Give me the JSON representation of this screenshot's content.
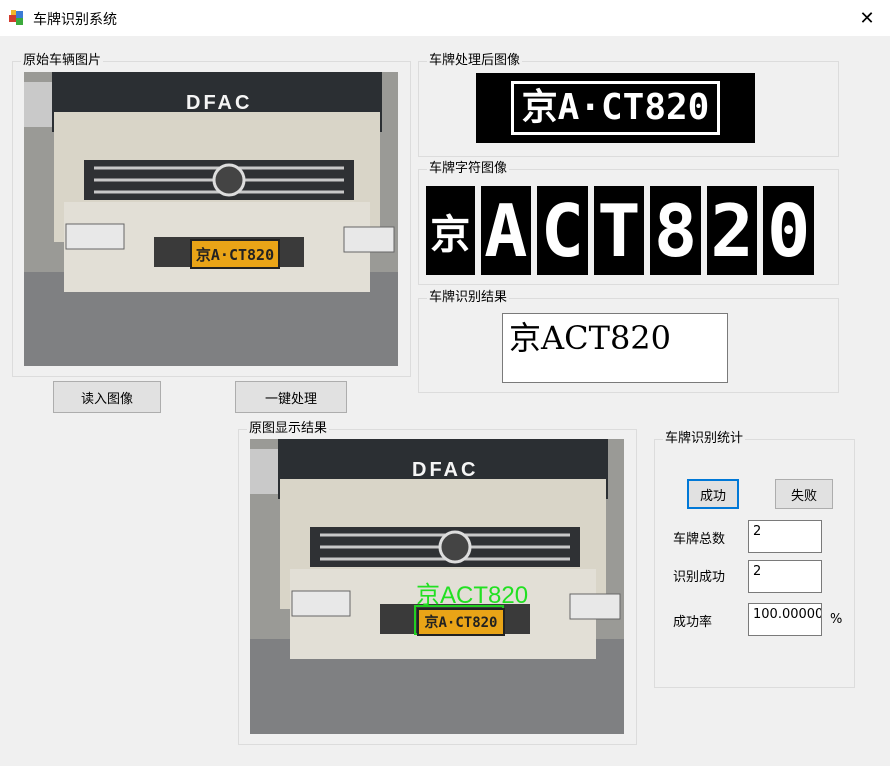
{
  "window": {
    "title": "车牌识别系统",
    "close_glyph": "✕"
  },
  "original_image": {
    "group_label": "原始车辆图片",
    "brand_text": "DFAC",
    "plate_text": "京A·CT820"
  },
  "processed_plate": {
    "group_label": "车牌处理后图像",
    "plate_text": "京A·CT820"
  },
  "char_images": {
    "group_label": "车牌字符图像",
    "chars": [
      "京",
      "A",
      "C",
      "T",
      "8",
      "2",
      "0"
    ]
  },
  "recognition_result": {
    "group_label": "车牌识别结果",
    "value": "京ACT820"
  },
  "buttons": {
    "read_image": "读入图像",
    "one_click": "一键处理"
  },
  "result_display": {
    "group_label": "原图显示结果",
    "overlay_text": "京ACT820",
    "brand_text": "DFAC",
    "plate_text": "京A·CT820"
  },
  "stats": {
    "group_label": "车牌识别统计",
    "success_button": "成功",
    "fail_button": "失败",
    "total_label": "车牌总数",
    "total_value": "2",
    "success_label": "识别成功",
    "success_value": "2",
    "rate_label": "成功率",
    "rate_value": "100.00000",
    "rate_unit": "%"
  }
}
